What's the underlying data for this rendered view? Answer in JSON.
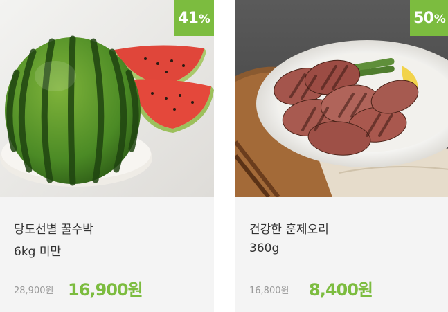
{
  "products": [
    {
      "image_alt": "watermelon",
      "discount": "41",
      "percent_sign": "%",
      "name_line1": "당도선별 꿀수박",
      "name_line2": "6kg 미만",
      "original_price": "28,900원",
      "sale_price": "16,900원"
    },
    {
      "image_alt": "smoked duck",
      "discount": "50",
      "percent_sign": "%",
      "name_line1": "건강한 훈제오리",
      "name_line2": "360g",
      "original_price": "16,800원",
      "sale_price": "8,400원"
    }
  ],
  "colors": {
    "accent": "#7cbc3f",
    "card_bg": "#f4f4f4",
    "name_text": "#333333",
    "original_price": "#999999"
  }
}
